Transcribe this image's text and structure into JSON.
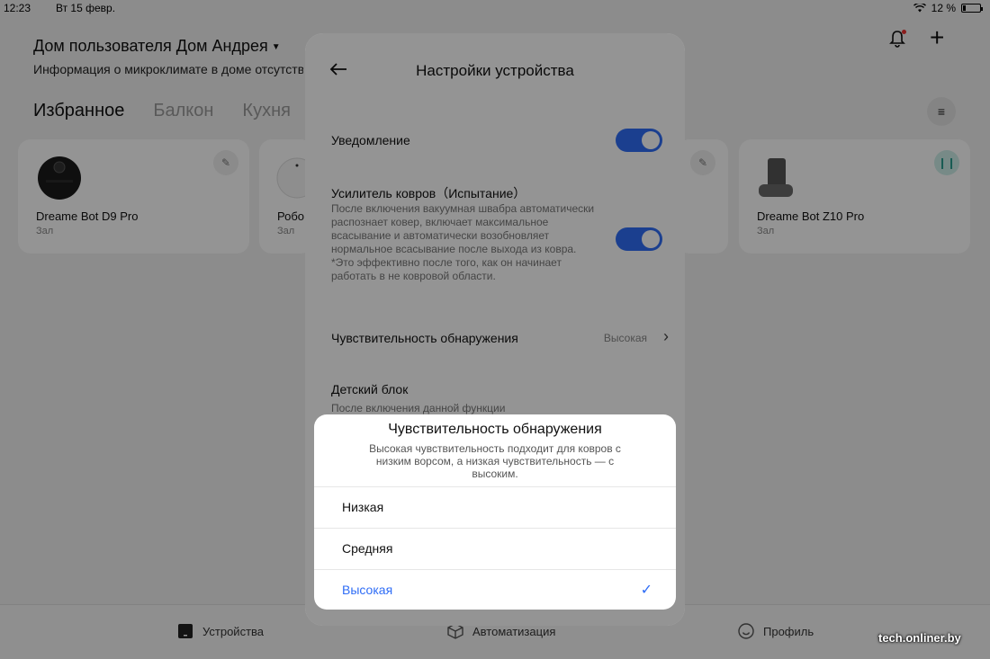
{
  "status_bar": {
    "time": "12:23",
    "date": "Вт 15 февр.",
    "battery": "12 %"
  },
  "home": {
    "title": "Дом пользователя Дом Андрея",
    "subtitle": "Информация о микроклимате в доме отсутствует"
  },
  "tabs": [
    "Избранное",
    "Балкон",
    "Кухня"
  ],
  "devices": [
    {
      "name": "Dreame Bot D9 Pro",
      "room": "Зал"
    },
    {
      "name": "Робо",
      "room": "Зал"
    },
    {
      "name": "Dreame Bot Z10 Pro",
      "room": "Зал"
    }
  ],
  "bottom_nav": {
    "devices": "Устройства",
    "automation": "Автоматизация",
    "profile": "Профиль"
  },
  "settings": {
    "title": "Настройки устройства",
    "notification_label": "Уведомление",
    "carpet_label": "Усилитель ковров（Испытание）",
    "carpet_desc": "После включения вакуумная швабра автоматически распознает ковер, включает максимальное всасывание и автоматически возобновляет нормальное всасывание после выхода из ковра.          *Это эффективно после того, как он начинает работать в не ковровой области.",
    "sensitivity_label": "Чувствительность обнаружения",
    "sensitivity_value": "Высокая",
    "child_lock_label": "Детский блок",
    "child_lock_desc": "После включения данной функции"
  },
  "sheet": {
    "title": "Чувствительность обнаружения",
    "description": "Высокая чувствительность подходит для ковров с низким ворсом, а низкая чувствительность — с высоким.",
    "options": [
      {
        "label": "Низкая",
        "selected": false
      },
      {
        "label": "Средняя",
        "selected": false
      },
      {
        "label": "Высокая",
        "selected": true
      }
    ]
  },
  "watermark": "tech.onliner.by",
  "colors": {
    "accent": "#2f6df6",
    "notification_dot": "#e33333",
    "pause_teal": "#2a9d8f"
  }
}
